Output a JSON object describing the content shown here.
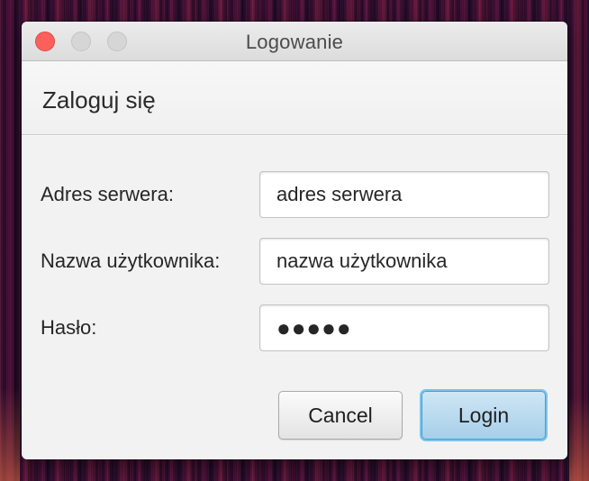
{
  "window": {
    "title": "Logowanie"
  },
  "dialog": {
    "header": "Zaloguj się"
  },
  "form": {
    "server": {
      "label": "Adres serwera:",
      "value": "adres serwera"
    },
    "username": {
      "label": "Nazwa użytkownika:",
      "value": "nazwa użytkownika"
    },
    "password": {
      "label": "Hasło:",
      "value": "●●●●●"
    }
  },
  "buttons": {
    "cancel": "Cancel",
    "login": "Login"
  },
  "colors": {
    "close_button": "#fc605c",
    "default_button_border": "#3aa3d8",
    "default_button_fill": "#a6cfe9"
  },
  "icons": {
    "close": "close-icon",
    "minimize": "minimize-icon",
    "maximize": "maximize-icon"
  }
}
